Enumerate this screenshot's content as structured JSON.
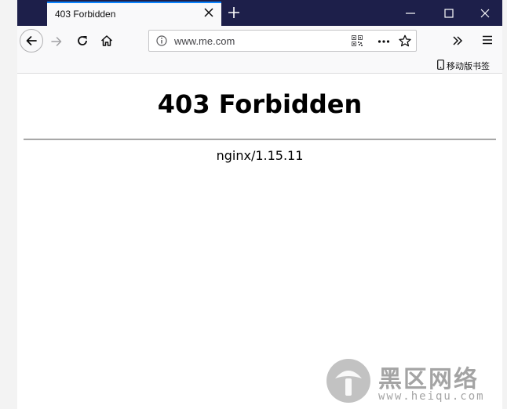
{
  "tab": {
    "title": "403 Forbidden"
  },
  "toolbar": {
    "url": "www.me.com"
  },
  "bookmarks": {
    "mobile_label": "移动版书签"
  },
  "page": {
    "heading": "403 Forbidden",
    "server": "nginx/1.15.11"
  },
  "watermark": {
    "brand": "黑区网络",
    "url": "www.heiqu.com"
  },
  "icons": {
    "tab_close": "close-icon",
    "new_tab": "plus-icon",
    "back": "arrow-left-icon",
    "forward": "arrow-right-icon",
    "reload": "reload-icon",
    "home": "home-icon",
    "info": "info-icon",
    "qr": "qr-code-icon",
    "more": "more-icon",
    "bookmark": "star-icon",
    "overflow": "chevron-double-right-icon",
    "menu": "hamburger-icon",
    "mobile": "mobile-phone-icon"
  },
  "colors": {
    "titlebar": "#1d1f4a",
    "active_tab_accent": "#0a84ff",
    "toolbar": "#f9f9fa"
  }
}
